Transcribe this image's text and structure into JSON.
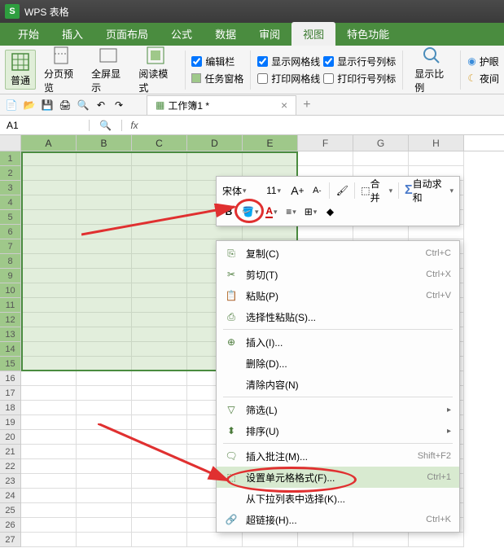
{
  "app": {
    "title": "WPS 表格"
  },
  "menu": {
    "tabs": [
      "开始",
      "插入",
      "页面布局",
      "公式",
      "数据",
      "审阅",
      "视图",
      "特色功能"
    ],
    "active_index": 6
  },
  "ribbon": {
    "big": {
      "normal": "普通",
      "page_preview": "分页预览",
      "fullscreen": "全屏显示",
      "read_mode": "阅读模式"
    },
    "checks_left": {
      "edit_bar": "编辑栏",
      "task_pane": "任务窗格"
    },
    "checks_mid": {
      "show_gridlines": "显示网格线",
      "print_gridlines": "打印网格线"
    },
    "checks_right": {
      "show_rowcol": "显示行号列标",
      "print_rowcol": "打印行号列标"
    },
    "zoom": "显示比例",
    "eyecare": "护眼",
    "night": "夜间"
  },
  "doc": {
    "tab_name": "工作簿1 *"
  },
  "namebox": {
    "value": "A1"
  },
  "columns": [
    "A",
    "B",
    "C",
    "D",
    "E",
    "F",
    "G",
    "H"
  ],
  "rows": [
    "1",
    "2",
    "3",
    "4",
    "5",
    "6",
    "7",
    "8",
    "9",
    "10",
    "11",
    "12",
    "13",
    "14",
    "15",
    "16",
    "17",
    "18",
    "19",
    "20",
    "21",
    "22",
    "23",
    "24",
    "25",
    "26",
    "27"
  ],
  "sel_cols": 5,
  "sel_rows": 15,
  "minitool": {
    "font": "宋体",
    "size": "11",
    "merge": "合并",
    "autosum": "自动求和"
  },
  "ctx": {
    "copy": "复制(C)",
    "copy_sc": "Ctrl+C",
    "cut": "剪切(T)",
    "cut_sc": "Ctrl+X",
    "paste": "粘贴(P)",
    "paste_sc": "Ctrl+V",
    "paste_special": "选择性粘贴(S)...",
    "insert": "插入(I)...",
    "delete": "删除(D)...",
    "clear": "清除内容(N)",
    "filter": "筛选(L)",
    "sort": "排序(U)",
    "comment": "插入批注(M)...",
    "comment_sc": "Shift+F2",
    "format": "设置单元格格式(F)...",
    "format_sc": "Ctrl+1",
    "dropdown": "从下拉列表中选择(K)...",
    "hyperlink": "超链接(H)...",
    "hyperlink_sc": "Ctrl+K"
  }
}
